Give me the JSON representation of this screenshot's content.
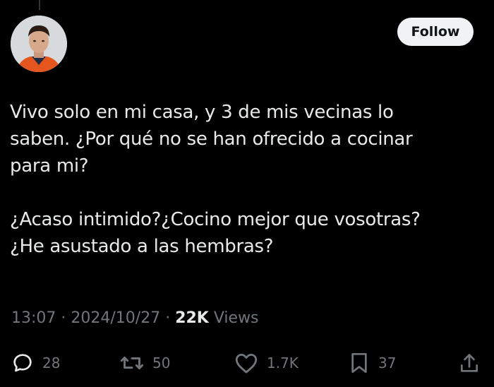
{
  "post": {
    "follow_label": "Follow",
    "paragraph_1": "Vivo solo en mi casa, y 3 de mis vecinas lo\nsaben. ¿Por qué no se han ofrecido a cocinar\npara mi?",
    "paragraph_2": "¿Acaso intimido?¿Cocino mejor que vosotras?\n¿He asustado a las hembras?",
    "time": "13:07",
    "separator": " · ",
    "date": "2024/10/27",
    "views_count": "22K",
    "views_label": " Views"
  },
  "actions": {
    "replies": "28",
    "reposts": "50",
    "likes": "1.7K",
    "bookmarks": "37"
  },
  "icons": {
    "reply": "reply-icon",
    "repost": "repost-icon",
    "like": "heart-icon",
    "bookmark": "bookmark-icon",
    "share": "share-icon"
  },
  "colors": {
    "background": "#000000",
    "text": "#e7e9ea",
    "muted": "#71767b",
    "follow_button_bg": "#eff3f4",
    "follow_button_text": "#0f1419"
  }
}
